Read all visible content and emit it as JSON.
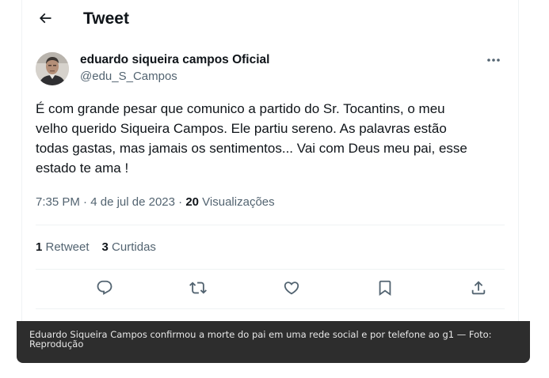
{
  "header": {
    "title": "Tweet",
    "back_icon": "arrow-left-icon"
  },
  "author": {
    "display_name": "eduardo siqueira campos Oficial",
    "handle": "@edu_S_Campos",
    "avatar_icon": "profile-photo",
    "more_icon": "more-horizontal-icon"
  },
  "tweet": {
    "lines": [
      "É com grande pesar que comunico a partido do Sr. Tocantins, o meu",
      "velho querido Siqueira Campos. Ele partiu sereno. As palavras estão",
      "todas gastas, mas jamais os sentimentos... Vai com Deus meu pai, esse",
      "estado te ama !"
    ]
  },
  "meta": {
    "time": "7:35 PM",
    "separator": " · ",
    "date": "4 de jul de 2023",
    "views_count": "20",
    "views_label": " Visualizações"
  },
  "stats": {
    "retweets_count": "1",
    "retweets_label": " Retweet",
    "likes_count": "3",
    "likes_label": " Curtidas"
  },
  "actions": {
    "icons": [
      "reply-icon",
      "retweet-icon",
      "like-icon",
      "bookmark-icon",
      "share-icon"
    ]
  },
  "colors": {
    "text": "#0f1419",
    "secondary": "#536471",
    "divider": "#eff3f4",
    "caption_bg": "#2d2d2d"
  },
  "caption": {
    "text": "Eduardo Siqueira Campos confirmou a morte do pai em uma rede social e por telefone ao g1 — Foto: Reprodução"
  }
}
